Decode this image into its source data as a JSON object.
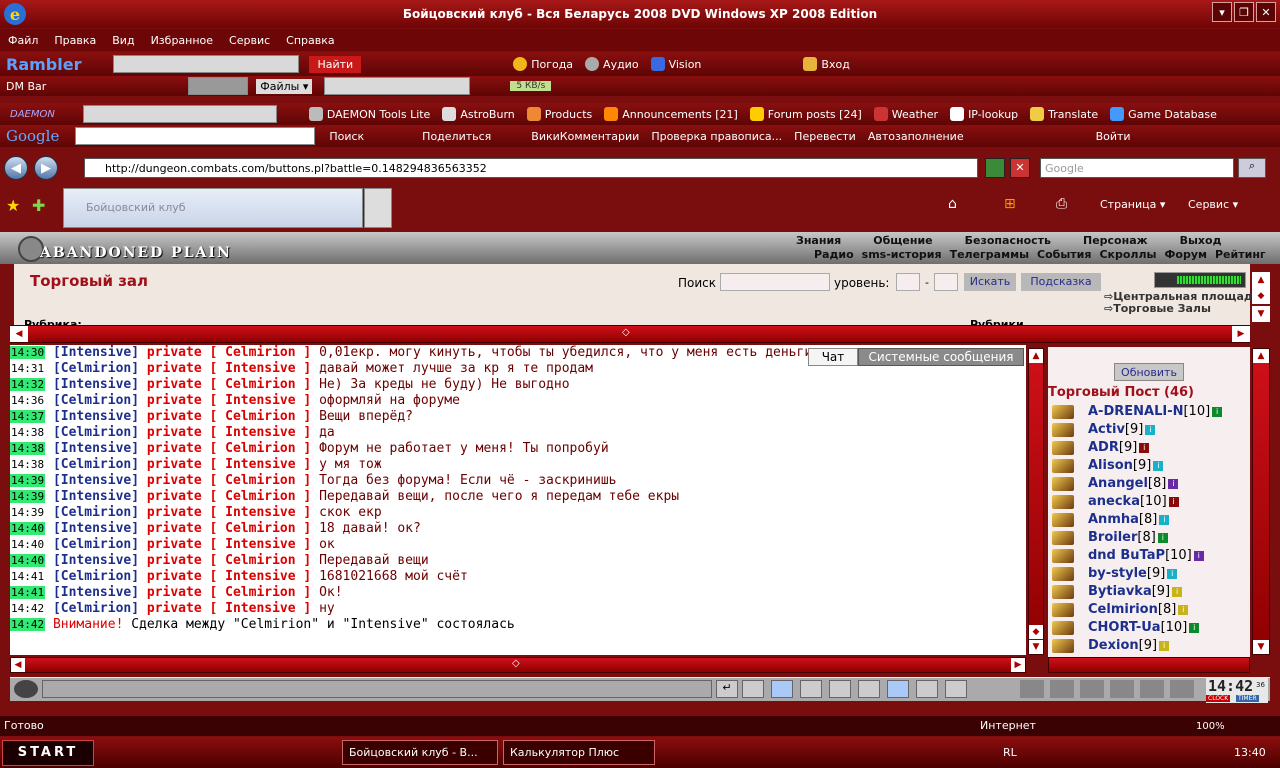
{
  "window": {
    "title": "Бойцовский клуб - Вся Беларусь 2008 DVD Windows XP 2008 Edition"
  },
  "menu": [
    "Файл",
    "Правка",
    "Вид",
    "Избранное",
    "Сервис",
    "Справка"
  ],
  "toolbar1": {
    "brand": "Rambler",
    "search_btn": "Найти",
    "weather": "Погода",
    "audio": "Аудио",
    "vision": "Vision",
    "login": "Вход"
  },
  "toolbar2": {
    "dmbar": "DM Bar",
    "files": "Файлы",
    "speed": "5 КВ/s"
  },
  "toolbar3": [
    "DAEMON Tools Lite",
    "AstroBurn",
    "Products",
    "Announcements [21]",
    "Forum posts [24]",
    "Weather",
    "IP-lookup",
    "Translate",
    "Game Database"
  ],
  "toolbar4": {
    "brand": "Google",
    "search": "Поиск",
    "share": "Поделиться",
    "wiki": "ВикиКомментарии",
    "spell": "Проверка правописа...",
    "translate": "Перевести",
    "autofill": "Автозаполнение",
    "signin": "Войти"
  },
  "address": {
    "url": "http://dungeon.combats.com/buttons.pl?battle=0.148294836563352",
    "search_placeholder": "Google"
  },
  "tab": {
    "label": "Бойцовский клуб"
  },
  "cmdbar": {
    "page": "Страница",
    "service": "Сервис"
  },
  "game": {
    "location": "ABANDONED PLAIN",
    "nav_top": [
      "Знания",
      "Общение",
      "Безопасность",
      "Персонаж",
      "Выход"
    ],
    "nav_bottom": [
      "Радио",
      "sms-история",
      "Телеграммы",
      "События",
      "Скроллы",
      "Форум",
      "Рейтинг"
    ],
    "hall_title": "Торговый зал",
    "search_label": "Поиск",
    "level_label": "уровень:",
    "level_dash": "-",
    "search_btn": "Искать",
    "hint_btn": "Подсказка",
    "links": [
      "Центральная площадь",
      "Торговые Залы"
    ],
    "rubric": "Рубрика:",
    "rubrics": "Рубрики"
  },
  "chat_tabs": {
    "chat": "Чат",
    "system": "Системные сообщения"
  },
  "chat": [
    {
      "time": "14:30",
      "hl": true,
      "from": "Intensive",
      "to": "Celmirion",
      "text": "0,01екр. могу кинуть, чтобы ты убедился, что у меня есть деньги"
    },
    {
      "time": "14:31",
      "hl": false,
      "from": "Celmirion",
      "to": "Intensive",
      "text": "давай может лучше за кр я те продам"
    },
    {
      "time": "14:32",
      "hl": true,
      "from": "Intensive",
      "to": "Celmirion",
      "text": "Не) За креды не буду) Не выгодно"
    },
    {
      "time": "14:36",
      "hl": false,
      "from": "Celmirion",
      "to": "Intensive",
      "text": "оформляй на форуме"
    },
    {
      "time": "14:37",
      "hl": true,
      "from": "Intensive",
      "to": "Celmirion",
      "text": "Вещи вперёд?"
    },
    {
      "time": "14:38",
      "hl": false,
      "from": "Celmirion",
      "to": "Intensive",
      "text": "да"
    },
    {
      "time": "14:38",
      "hl": true,
      "from": "Intensive",
      "to": "Celmirion",
      "text": "Форум не работает у меня! Ты попробуй"
    },
    {
      "time": "14:38",
      "hl": false,
      "from": "Celmirion",
      "to": "Intensive",
      "text": "у мя тож"
    },
    {
      "time": "14:39",
      "hl": true,
      "from": "Intensive",
      "to": "Celmirion",
      "text": "Тогда без форума! Если чё - заскринишь"
    },
    {
      "time": "14:39",
      "hl": true,
      "from": "Intensive",
      "to": "Celmirion",
      "text": "Передавай вещи, после чего я передам тебе екры"
    },
    {
      "time": "14:39",
      "hl": false,
      "from": "Celmirion",
      "to": "Intensive",
      "text": "скок екр"
    },
    {
      "time": "14:40",
      "hl": true,
      "from": "Intensive",
      "to": "Celmirion",
      "text": "18 давай! ок?"
    },
    {
      "time": "14:40",
      "hl": false,
      "from": "Celmirion",
      "to": "Intensive",
      "text": "ок"
    },
    {
      "time": "14:40",
      "hl": true,
      "from": "Intensive",
      "to": "Celmirion",
      "text": "Передавай вещи"
    },
    {
      "time": "14:41",
      "hl": false,
      "from": "Celmirion",
      "to": "Intensive",
      "text": "1681021668 мой счёт"
    },
    {
      "time": "14:41",
      "hl": true,
      "from": "Intensive",
      "to": "Celmirion",
      "text": "Ок!"
    },
    {
      "time": "14:42",
      "hl": false,
      "from": "Celmirion",
      "to": "Intensive",
      "text": "ну"
    }
  ],
  "chat_system": {
    "time": "14:42",
    "label": "Внимание!",
    "text": "Сделка между \"Celmirion\" и \"Intensive\" состоялась"
  },
  "chat_private": "private",
  "users_panel": {
    "refresh": "Обновить",
    "title": "Торговый Пост (46)",
    "users": [
      {
        "name": "A-DRENALI-N",
        "level": "[10]",
        "info_color": "#0a8a2a"
      },
      {
        "name": "Activ",
        "level": "[9]",
        "info_color": "#1ab0c8"
      },
      {
        "name": "ADR",
        "level": "[9]",
        "info_color": "#8a0a0a"
      },
      {
        "name": "Alison",
        "level": "[9]",
        "info_color": "#1ab0c8"
      },
      {
        "name": "Anangel",
        "level": "[8]",
        "info_color": "#6a2aa8"
      },
      {
        "name": "anecka",
        "level": "[10]",
        "info_color": "#8a0a0a"
      },
      {
        "name": "Anmha",
        "level": "[8]",
        "info_color": "#1ab0c8"
      },
      {
        "name": "Broiler",
        "level": "[8]",
        "info_color": "#0a8a2a"
      },
      {
        "name": "dnd BuTaP",
        "level": "[10]",
        "info_color": "#6a2aa8"
      },
      {
        "name": "by-style",
        "level": "[9]",
        "info_color": "#1ab0c8"
      },
      {
        "name": "Bytiavka",
        "level": "[9]",
        "info_color": "#c8b41a"
      },
      {
        "name": "Celmirion",
        "level": "[8]",
        "info_color": "#c8b41a"
      },
      {
        "name": "CHORT-Ua",
        "level": "[10]",
        "info_color": "#0a8a2a"
      },
      {
        "name": "Dexion",
        "level": "[9]",
        "info_color": "#c8b41a"
      }
    ]
  },
  "clock": {
    "time": "14:42",
    "seconds": "36",
    "clock_label": "CLOCK",
    "timer_label": "TIMER"
  },
  "status": {
    "text": "Готово",
    "zone": "Интернет",
    "zoom": "100%"
  },
  "taskbar": {
    "start": "START",
    "tasks": [
      "Бойцовский клуб - В...",
      "Калькулятор Плюс"
    ],
    "lang": "RL",
    "time": "13:40"
  }
}
